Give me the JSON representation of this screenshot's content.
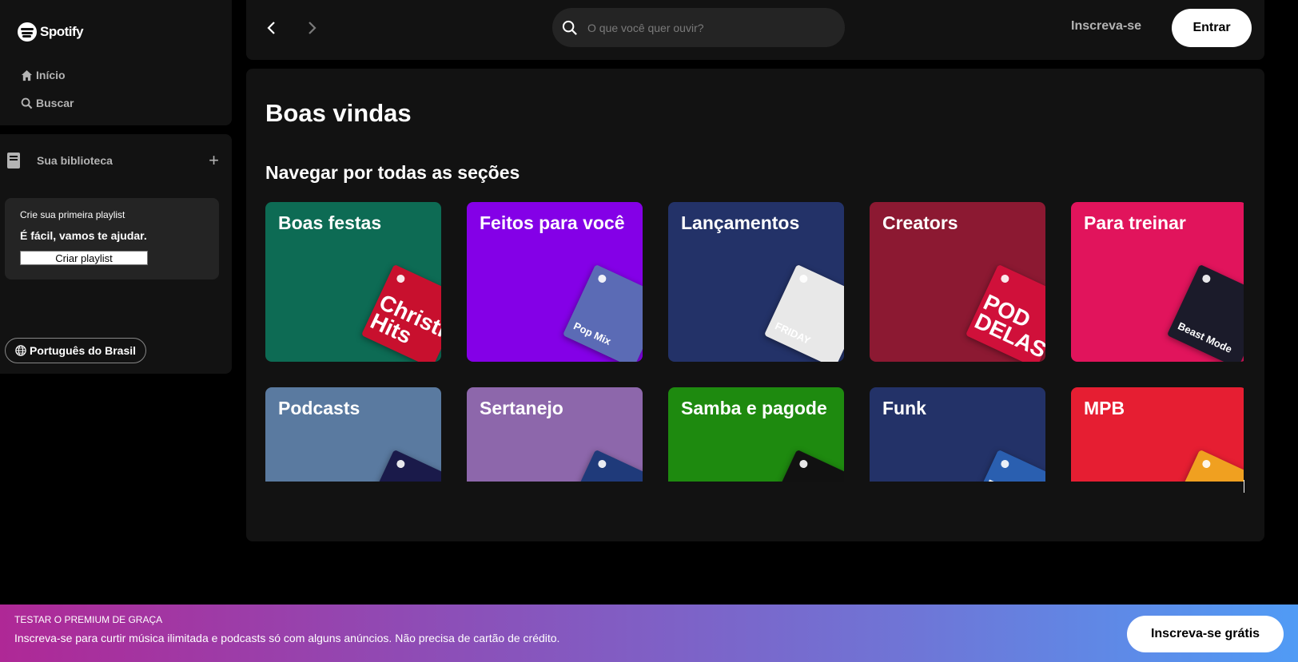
{
  "sidebar": {
    "logo_text": "Spotify",
    "nav": [
      {
        "label": "Início",
        "icon": "home-icon"
      },
      {
        "label": "Buscar",
        "icon": "search-icon"
      }
    ],
    "library": {
      "title": "Sua biblioteca",
      "add_icon": "plus-icon",
      "promo": {
        "line1": "Crie sua primeira playlist",
        "line2": "É fácil, vamos te ajudar.",
        "button": "Criar playlist"
      }
    },
    "language_button": "Português do Brasil"
  },
  "topbar": {
    "search_placeholder": "O que você quer ouvir?",
    "signup": "Inscreva-se",
    "login": "Entrar"
  },
  "main": {
    "welcome": "Boas vindas",
    "section_title": "Navegar por todas as seções",
    "cards": [
      {
        "label": "Boas festas",
        "bg": "#0d6b54",
        "art_bg": "#c8102e",
        "art_text": "Christmas Hits",
        "art_style": "big"
      },
      {
        "label": "Feitos para você",
        "bg": "#8400e7",
        "art_bg": "#5b6bb5",
        "art_text": "Pop Mix",
        "art_style": "small"
      },
      {
        "label": "Lançamentos",
        "bg": "#233268",
        "art_bg": "#e8e8e8",
        "art_text": "FRIDAY",
        "art_style": "small"
      },
      {
        "label": "Creators",
        "bg": "#8c1932",
        "art_bg": "#d0103a",
        "art_text": "POD DELAS",
        "art_style": "big"
      },
      {
        "label": "Para treinar",
        "bg": "#e1145c",
        "art_bg": "#1b1b2a",
        "art_text": "Beast Mode",
        "art_style": "small"
      },
      {
        "label": "Podcasts",
        "bg": "#5a7aa0",
        "art_bg": "#1a1a4a",
        "art_text": "",
        "art_style": "small"
      },
      {
        "label": "Sertanejo",
        "bg": "#8d67ab",
        "art_bg": "#1f3a7a",
        "art_text": "",
        "art_style": "small"
      },
      {
        "label": "Samba e pagode",
        "bg": "#1e8a0f",
        "art_bg": "#111111",
        "art_text": "",
        "art_style": "small"
      },
      {
        "label": "Funk",
        "bg": "#233268",
        "art_bg": "#2a5fb0",
        "art_text": "FU",
        "art_style": "big"
      },
      {
        "label": "MPB",
        "bg": "#e61e32",
        "art_bg": "#f0a020",
        "art_text": "",
        "art_style": "small"
      }
    ]
  },
  "banner": {
    "title": "TESTAR O PREMIUM DE GRAÇA",
    "text": "Inscreva-se para curtir música ilimitada e podcasts só com alguns anúncios. Não precisa de cartão de crédito.",
    "button": "Inscreva-se grátis"
  }
}
